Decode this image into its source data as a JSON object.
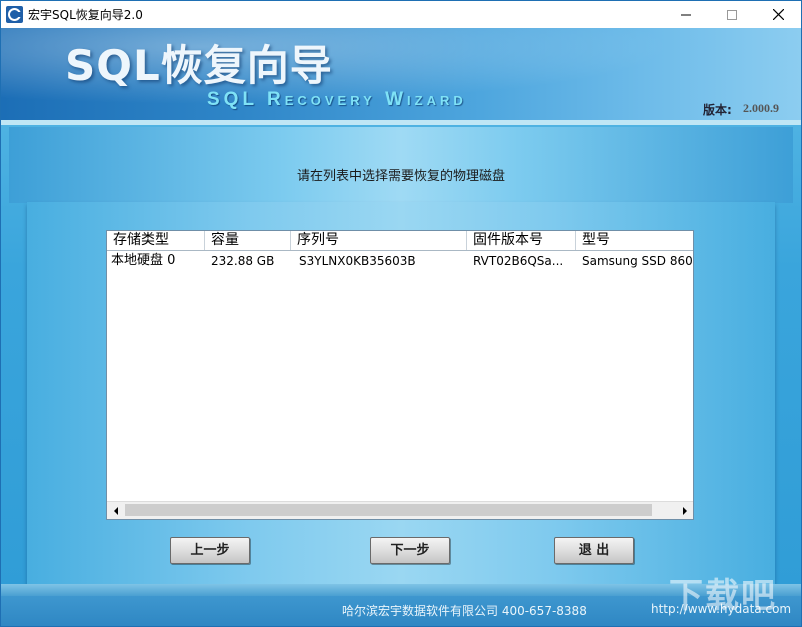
{
  "window": {
    "title": "宏宇SQL恢复向导2.0"
  },
  "banner": {
    "title": "SQL恢复向导",
    "subtitle": "SQL Recovery Wizard",
    "version_label": "版本:",
    "version_value": "2.000.9"
  },
  "instruction": "请在列表中选择需要恢复的物理磁盘",
  "table": {
    "columns": [
      "存储类型",
      "容量",
      "序列号",
      "固件版本号",
      "型号"
    ],
    "rows": [
      [
        "本地硬盘 0",
        "232.88 GB",
        "S3YLNX0KB35603B",
        "RVT02B6QSa...",
        "Samsung SSD 860"
      ]
    ]
  },
  "buttons": {
    "prev": "上一步",
    "next": "下一步",
    "exit": "退 出"
  },
  "footer": {
    "company": "哈尔滨宏宇数据软件有限公司  400-657-8388",
    "url": "http://www.hydata.com"
  },
  "watermark": "下载吧",
  "icons": {
    "app": "app-logo-icon",
    "minimize": "minimize-icon",
    "maximize": "maximize-icon",
    "close": "close-icon"
  },
  "colors": {
    "banner_dark": "#1c6eb6",
    "panel": "#48aee0",
    "subtitle": "#7fe2f6"
  }
}
